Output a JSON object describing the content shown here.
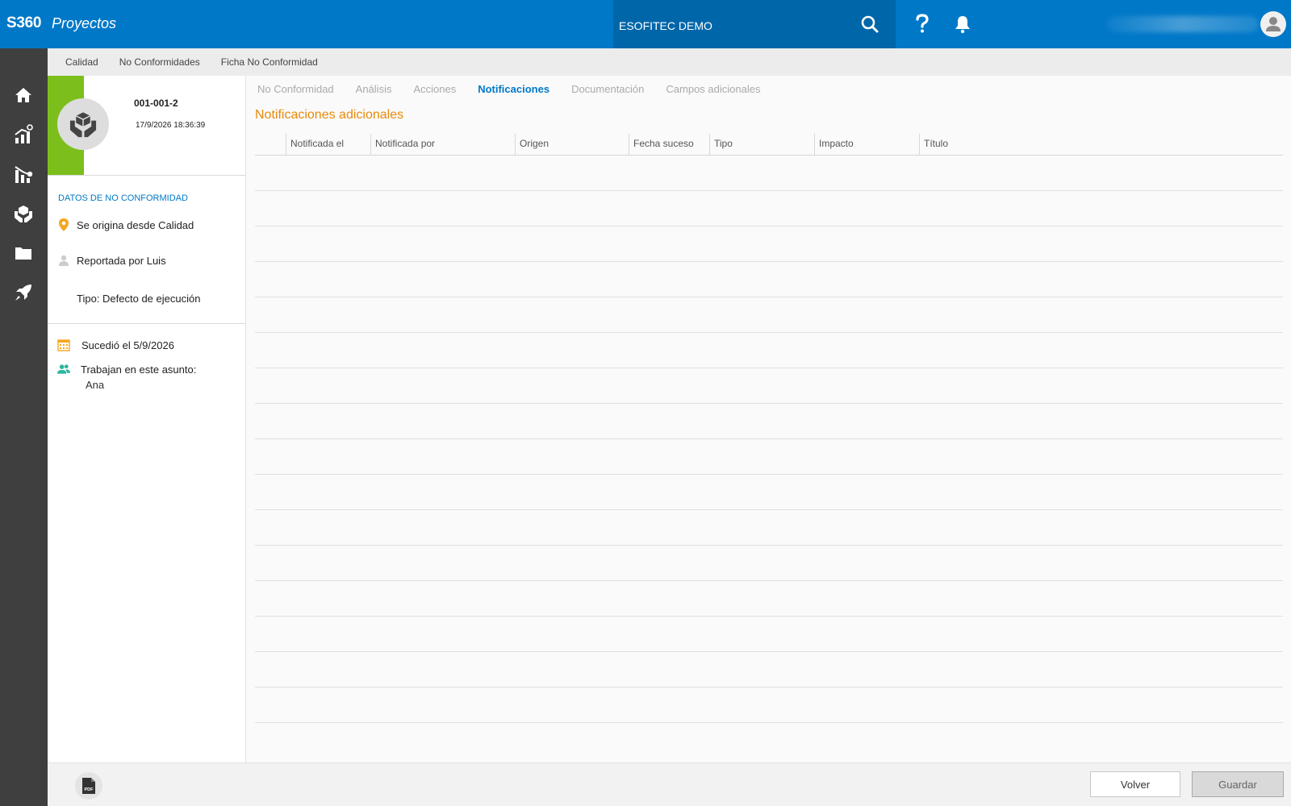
{
  "app": {
    "brand": "S360",
    "module": "Proyectos",
    "company": "ESOFITEC DEMO"
  },
  "topbar": {
    "icons": [
      "search-icon",
      "help-icon",
      "bell-icon",
      "user-avatar-icon"
    ]
  },
  "sidebar": {
    "items": [
      "home-icon",
      "analytics-icon",
      "chart-icon",
      "quality-icon",
      "folder-icon",
      "rocket-icon"
    ]
  },
  "breadcrumb": [
    "Calidad",
    "No Conformidades",
    "Ficha No Conformidad"
  ],
  "record": {
    "code": "001-001-2",
    "datetime": "17/9/2026 18:36:39",
    "section_title": "DATOS DE NO CONFORMIDAD",
    "origin": "Se origina desde Calidad",
    "reported_by": "Reportada por Luis",
    "type": "Tipo: Defecto de ejecución",
    "occurred": "Sucedió el 5/9/2026",
    "workers_label": "Trabajan en este asunto:",
    "workers": [
      "Ana"
    ]
  },
  "tabs": [
    {
      "label": "No Conformidad",
      "active": false
    },
    {
      "label": "Análisis",
      "active": false
    },
    {
      "label": "Acciones",
      "active": false
    },
    {
      "label": "Notificaciones",
      "active": true
    },
    {
      "label": "Documentación",
      "active": false
    },
    {
      "label": "Campos adicionales",
      "active": false
    }
  ],
  "main": {
    "title": "Notificaciones adicionales",
    "columns": [
      "",
      "Notificada el",
      "Notificada por",
      "Origen",
      "Fecha suceso",
      "Tipo",
      "Impacto",
      "Título"
    ],
    "rows": []
  },
  "footer": {
    "back_label": "Volver",
    "save_label": "Guardar",
    "pdf_label": "PDF"
  },
  "colors": {
    "primary": "#0078c8",
    "accent": "#e88a0a",
    "green": "#7cbf1d",
    "sidebar": "#3f3f3f"
  }
}
